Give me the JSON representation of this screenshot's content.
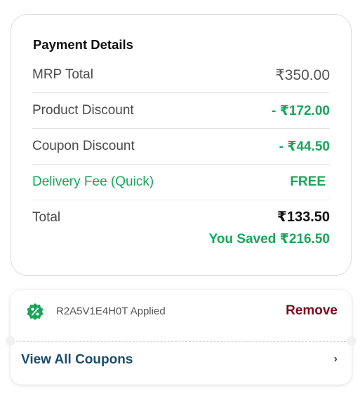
{
  "payment": {
    "title": "Payment Details",
    "rows": [
      {
        "label": "MRP Total",
        "value": "₹350.00"
      },
      {
        "label": "Product Discount",
        "value": "- ₹172.00"
      },
      {
        "label": "Coupon Discount",
        "value": "- ₹44.50"
      },
      {
        "label": "Delivery Fee (Quick)",
        "value": "FREE"
      }
    ],
    "total_label": "Total",
    "total_value": "₹133.50",
    "saved_text": "You Saved ₹216.50"
  },
  "coupon": {
    "applied_text": "R2A5V1E4H0T Applied",
    "remove_label": "Remove",
    "view_all_label": "View All Coupons",
    "chevron": "›",
    "badge_icon": "discount-badge-icon"
  },
  "colors": {
    "green": "#1aa55a",
    "remove": "#7a0f1e",
    "link": "#1c4d6e"
  }
}
